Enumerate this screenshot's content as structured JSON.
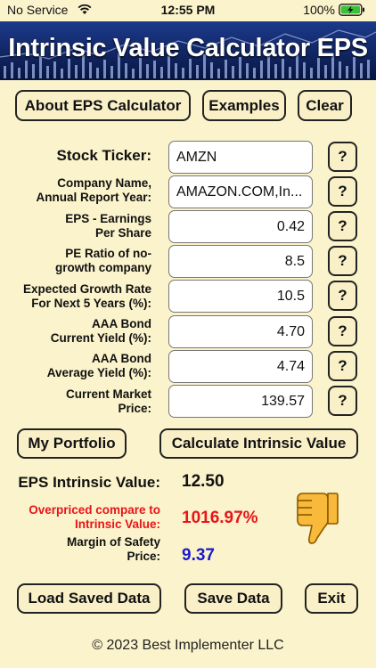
{
  "status_bar": {
    "carrier": "No Service",
    "time": "12:55 PM",
    "battery": "100%"
  },
  "header": {
    "title": "Intrinsic Value Calculator EPS"
  },
  "top_buttons": {
    "about": "About EPS Calculator",
    "examples": "Examples",
    "clear": "Clear"
  },
  "help_label": "?",
  "form": {
    "ticker": {
      "label": "Stock Ticker:",
      "value": "AMZN"
    },
    "company": {
      "label1": "Company Name,",
      "label2": "Annual Report Year:",
      "value": "AMAZON.COM,In..."
    },
    "eps": {
      "label1": "EPS - Earnings",
      "label2": "Per Share",
      "value": "0.42"
    },
    "pe": {
      "label1": "PE Ratio of no-",
      "label2": "growth company",
      "value": "8.5"
    },
    "growth": {
      "label1": "Expected Growth Rate",
      "label2": "For Next 5 Years (%):",
      "value": "10.5"
    },
    "aaa_current": {
      "label1": "AAA Bond",
      "label2": "Current Yield (%):",
      "value": "4.70"
    },
    "aaa_average": {
      "label1": "AAA Bond",
      "label2": "Average Yield (%):",
      "value": "4.74"
    },
    "price": {
      "label1": "Current Market",
      "label2": "Price:",
      "value": "139.57"
    }
  },
  "action_buttons": {
    "portfolio": "My Portfolio",
    "calculate": "Calculate Intrinsic Value"
  },
  "results": {
    "intrinsic": {
      "label": "EPS Intrinsic Value:",
      "value": "12.50"
    },
    "overpriced": {
      "label1": "Overpriced compare to",
      "label2": "Intrinsic Value:",
      "value": "1016.97%"
    },
    "margin": {
      "label1": "Margin of Safety",
      "label2": "Price:",
      "value": "9.37"
    }
  },
  "bottom_buttons": {
    "load": "Load Saved Data",
    "save": "Save Data",
    "exit": "Exit"
  },
  "footer": "© 2023 Best Implementer LLC",
  "colors": {
    "overpriced": "#e8141a",
    "margin": "#1a1acc",
    "banner": "#0c2060",
    "background": "#fbf3cb"
  },
  "icons": {
    "verdict": "thumbs-down-icon"
  }
}
